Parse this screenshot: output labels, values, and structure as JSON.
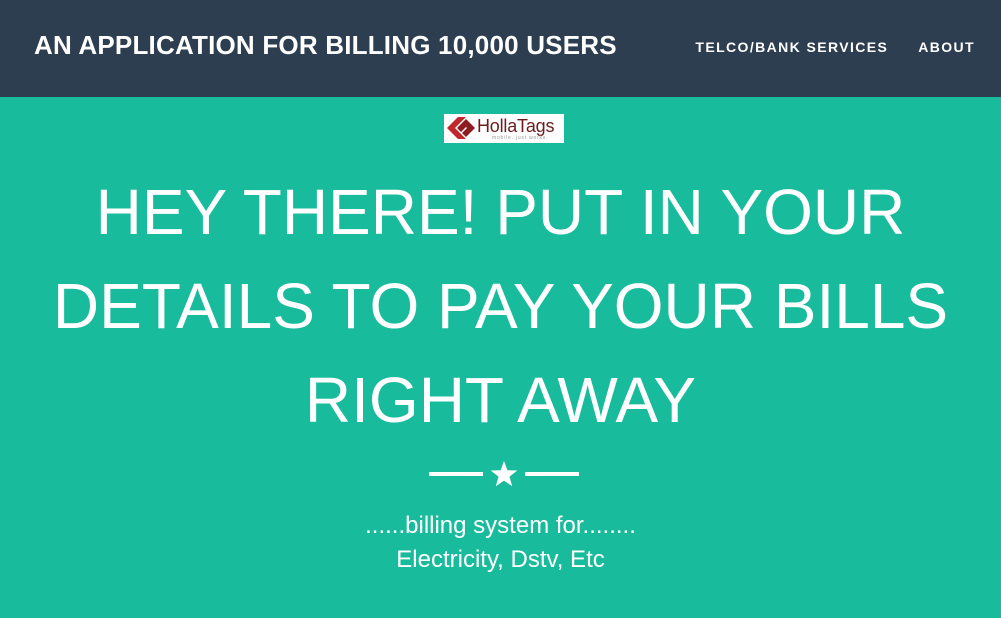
{
  "navbar": {
    "brand": "AN APPLICATION FOR BILLING 10,000 USERS",
    "links": [
      {
        "label": "TELCO/BANK SERVICES"
      },
      {
        "label": "ABOUT"
      }
    ]
  },
  "hero": {
    "logo": {
      "name": "HollaTags",
      "tagline": "mobile. just works."
    },
    "headline": "HEY THERE! PUT IN YOUR DETAILS TO PAY YOUR BILLS RIGHT AWAY",
    "divider_icon": "star-icon",
    "subtitle_line1": "......billing system for........",
    "subtitle_line2": "Electricity, Dstv, Etc"
  },
  "colors": {
    "navbar_bg": "#2c3e50",
    "hero_bg": "#18bc9c",
    "text": "#ffffff",
    "logo_red": "#c0272d"
  }
}
